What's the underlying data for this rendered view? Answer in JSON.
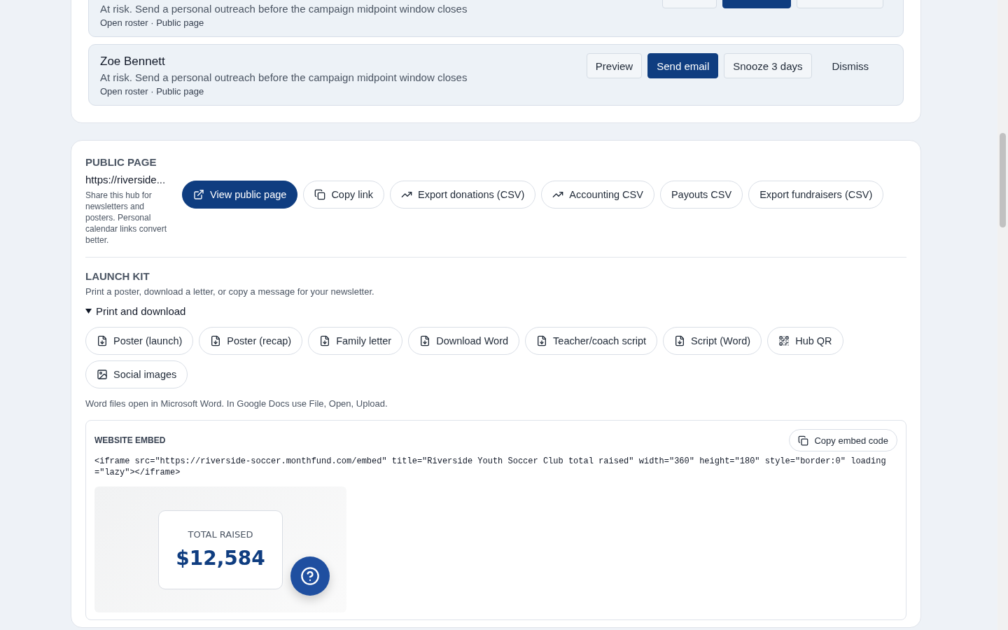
{
  "alerts": [
    {
      "message": "At risk. Send a personal outreach before the campaign midpoint window closes",
      "meta": "Open roster · Public page",
      "actions": [
        {
          "kind": "outline"
        },
        {
          "kind": "primary"
        },
        {
          "kind": "outline"
        }
      ]
    },
    {
      "name": "Zoe Bennett",
      "message": "At risk. Send a personal outreach before the campaign midpoint window closes",
      "meta": "Open roster · Public page",
      "actions": [
        {
          "label": "Preview",
          "kind": "outline"
        },
        {
          "label": "Send email",
          "kind": "primary"
        },
        {
          "label": "Snooze 3 days",
          "kind": "outline"
        },
        {
          "label": "Dismiss",
          "kind": "plain"
        }
      ]
    }
  ],
  "public_page": {
    "title": "PUBLIC PAGE",
    "url": "https://riverside...",
    "note": "Share this hub for newsletters and posters. Personal calendar links convert better.",
    "buttons": [
      {
        "label": "View public page",
        "kind": "primary"
      },
      {
        "label": "Copy link",
        "kind": "copy"
      },
      {
        "label": "Export donations (CSV)",
        "kind": "trend"
      },
      {
        "label": "Accounting CSV",
        "kind": "trend"
      },
      {
        "label": "Payouts CSV",
        "kind": "plain"
      },
      {
        "label": "Export fundraisers (CSV)",
        "kind": "plain"
      }
    ]
  },
  "launch_kit": {
    "title": "LAUNCH KIT",
    "subtitle": "Print a poster, download a letter, or copy a message for your newsletter.",
    "section": {
      "label": "Print and download",
      "expanded": true
    },
    "buttons": [
      {
        "label": "Poster (launch)",
        "kind": "file"
      },
      {
        "label": "Poster (recap)",
        "kind": "file"
      },
      {
        "label": "Family letter",
        "kind": "file"
      },
      {
        "label": "Download Word",
        "kind": "file"
      },
      {
        "label": "Teacher/coach script",
        "kind": "file"
      },
      {
        "label": "Script (Word)",
        "kind": "file"
      },
      {
        "label": "Hub QR",
        "kind": "qr"
      },
      {
        "label": "Social images",
        "kind": "image"
      }
    ],
    "footnote": "Word files open in Microsoft Word. In Google Docs use File, Open, Upload."
  },
  "embed": {
    "title": "WEBSITE EMBED",
    "copy_button": "Copy embed code",
    "code": "<iframe src=\"https://riverside-soccer.monthfund.com/embed\" title=\"Riverside Youth Soccer Club total raised\" width=\"360\" height=\"180\" style=\"border:0\" loading =\"lazy\"></iframe>",
    "preview": {
      "label": "TOTAL RAISED",
      "amount": "$12,584"
    }
  }
}
